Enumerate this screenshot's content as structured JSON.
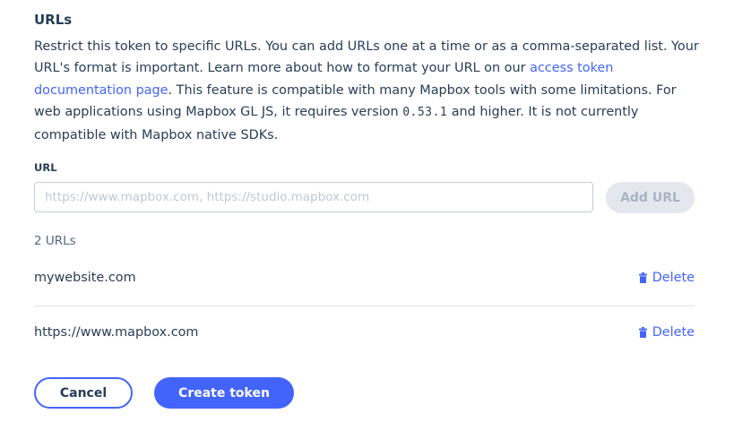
{
  "section": {
    "title": "URLs",
    "description": {
      "part1": "Restrict this token to specific URLs. You can add URLs one at a time or as a comma-separated list. Your URL's format is important. Learn more about how to format your URL on our ",
      "link_text": "access token documentation page",
      "part2": ". This feature is compatible with many Mapbox tools with some limitations. For web applications using Mapbox GL JS, it requires version ",
      "version": "0.53.1",
      "part3": " and higher. It is not currently compatible with Mapbox native SDKs."
    }
  },
  "url_field": {
    "label": "URL",
    "value": "",
    "placeholder": "https://www.mapbox.com, https://studio.mapbox.com",
    "add_button_label": "Add URL"
  },
  "url_list": {
    "count_label": "2 URLs",
    "items": [
      {
        "url": "mywebsite.com",
        "delete_label": "Delete",
        "delete_icon": "trash-icon"
      },
      {
        "url": "https://www.mapbox.com",
        "delete_label": "Delete",
        "delete_icon": "trash-icon"
      }
    ]
  },
  "actions": {
    "cancel_label": "Cancel",
    "create_label": "Create token"
  },
  "colors": {
    "text": "#273d56",
    "accent": "#4264fb",
    "muted": "#4f6a86",
    "disabled_bg": "#e4e8ee",
    "disabled_text": "#a9b4c2"
  }
}
